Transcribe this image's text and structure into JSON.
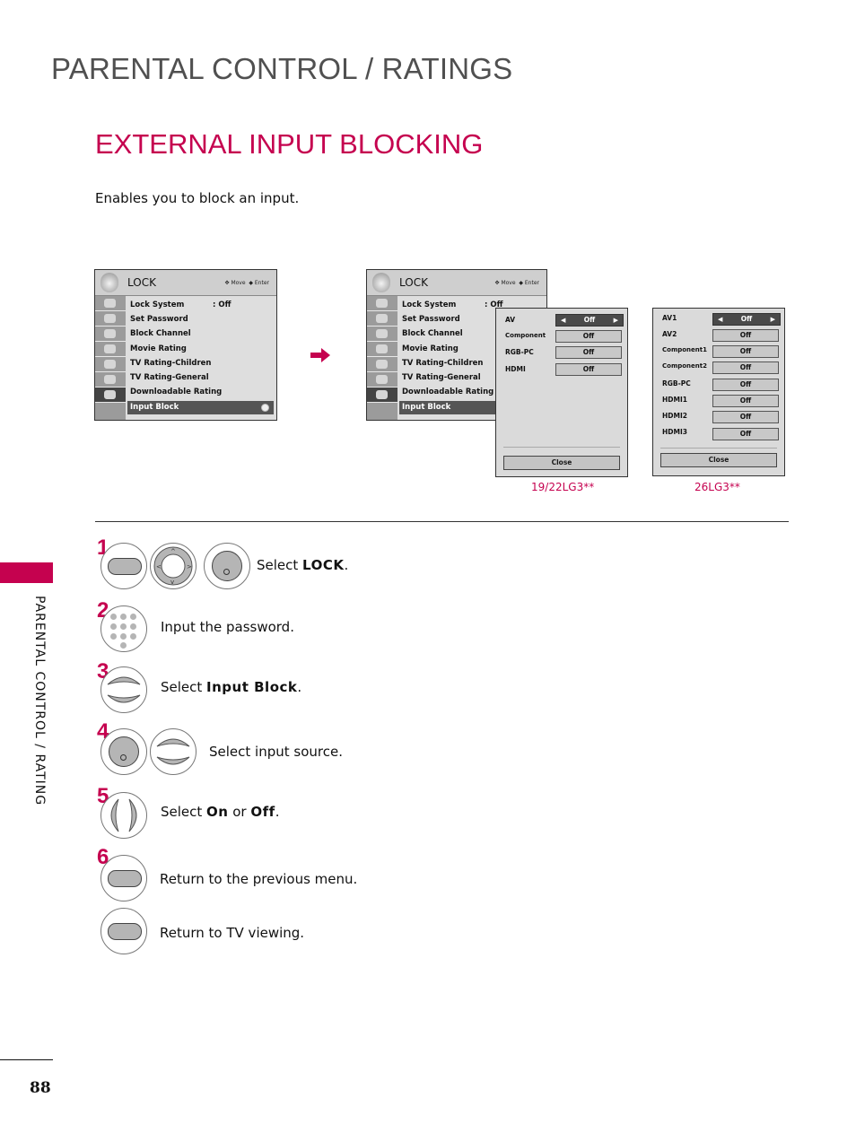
{
  "page": {
    "title": "PARENTAL CONTROL / RATINGS",
    "section_title": "EXTERNAL INPUT BLOCKING",
    "intro": "Enables you to block an input.",
    "side_label": "PARENTAL CONTROL / RATING",
    "page_number": "88",
    "accent_color": "#c5024f"
  },
  "lock_menu": {
    "title": "LOCK",
    "hint_move": "Move",
    "hint_enter": "Enter",
    "items": [
      {
        "label": "Lock System",
        "value": ": Off"
      },
      {
        "label": "Set Password",
        "value": ""
      },
      {
        "label": "Block Channel",
        "value": ""
      },
      {
        "label": "Movie Rating",
        "value": ""
      },
      {
        "label": "TV Rating-Children",
        "value": ""
      },
      {
        "label": "TV Rating-General",
        "value": ""
      },
      {
        "label": "Downloadable Rating",
        "value": ""
      },
      {
        "label": "Input Block",
        "value": ""
      }
    ],
    "selected": "Input Block"
  },
  "popup_small": {
    "model": "19/22LG3**",
    "rows": [
      {
        "label": "AV",
        "value": "Off"
      },
      {
        "label": "Component",
        "value": "Off"
      },
      {
        "label": "RGB-PC",
        "value": "Off"
      },
      {
        "label": "HDMI",
        "value": "Off"
      }
    ],
    "close_label": "Close"
  },
  "popup_large": {
    "model": "26LG3**",
    "rows": [
      {
        "label": "AV1",
        "value": "Off"
      },
      {
        "label": "AV2",
        "value": "Off"
      },
      {
        "label": "Component1",
        "value": "Off"
      },
      {
        "label": "Component2",
        "value": "Off"
      },
      {
        "label": "RGB-PC",
        "value": "Off"
      },
      {
        "label": "HDMI1",
        "value": "Off"
      },
      {
        "label": "HDMI2",
        "value": "Off"
      },
      {
        "label": "HDMI3",
        "value": "Off"
      }
    ],
    "close_label": "Close"
  },
  "steps": [
    {
      "num": "1",
      "prefix": "Select ",
      "bold": "LOCK",
      "suffix": "."
    },
    {
      "num": "2",
      "prefix": "Input the password.",
      "bold": "",
      "suffix": ""
    },
    {
      "num": "3",
      "prefix": "Select ",
      "bold": "Input Block",
      "suffix": "."
    },
    {
      "num": "4",
      "prefix": "Select input source.",
      "bold": "",
      "suffix": ""
    },
    {
      "num": "5",
      "prefix": "Select ",
      "bold": "On",
      "mid": " or ",
      "bold2": "Off",
      "suffix": "."
    },
    {
      "num": "6",
      "prefix": "Return to the previous menu.",
      "bold": "",
      "suffix": ""
    },
    {
      "num": "",
      "prefix": "Return to TV viewing.",
      "bold": "",
      "suffix": ""
    }
  ]
}
